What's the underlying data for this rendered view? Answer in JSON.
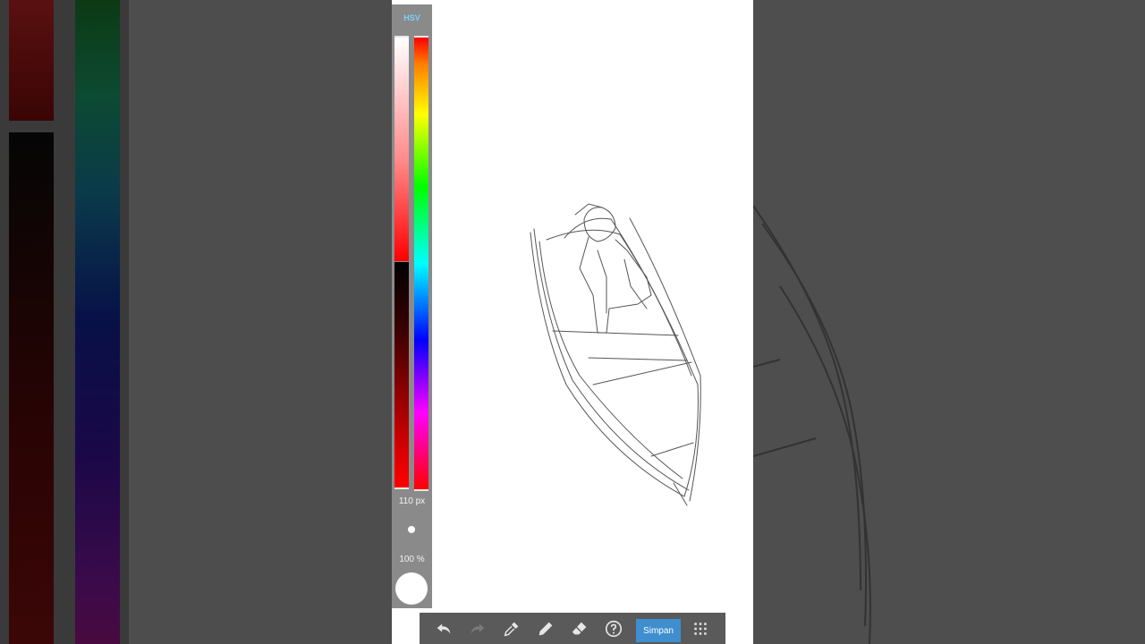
{
  "color_panel": {
    "mode_label": "HSV",
    "brush_size": "110 px",
    "opacity": "100 %",
    "current_color": "#ffffff"
  },
  "toolbar": {
    "save_label": "Simpan",
    "tools": [
      "undo-icon",
      "redo-icon",
      "eyedropper-icon",
      "pen-icon",
      "eraser-icon",
      "help-icon",
      "grid-menu-icon"
    ]
  },
  "colors": {
    "accent": "#3e8ed0",
    "panel": "#8a8a8a",
    "toolbar": "#5a5a5a",
    "canvas": "#ffffff"
  }
}
